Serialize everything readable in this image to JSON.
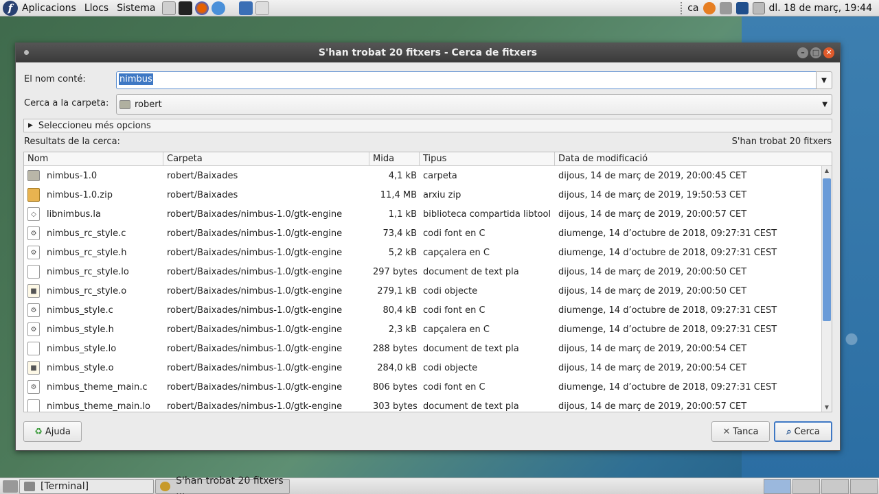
{
  "top_panel": {
    "menus": [
      "Aplicacions",
      "Llocs",
      "Sistema"
    ],
    "keyboard_layout": "ca",
    "clock": "dl. 18 de març, 19:44"
  },
  "window": {
    "title": "S'han trobat 20 fitxers - Cerca de fitxers",
    "name_label": "El nom conté:",
    "name_value": "nimbus",
    "folder_label": "Cerca a la carpeta:",
    "folder_value": "robert",
    "more_options": "Seleccioneu més opcions",
    "results_label": "Resultats de la cerca:",
    "results_count": "S'han trobat 20 fitxers",
    "columns": {
      "name": "Nom",
      "folder": "Carpeta",
      "size": "Mida",
      "type": "Tipus",
      "date": "Data de modificació"
    },
    "rows": [
      {
        "name": "nimbus-1.0",
        "folder": "robert/Baixades",
        "size": "4,1 kB",
        "type": "carpeta",
        "date": "dijous, 14 de març de 2019, 20:00:45 CET",
        "icon": "folder"
      },
      {
        "name": "nimbus-1.0.zip",
        "folder": "robert/Baixades",
        "size": "11,4 MB",
        "type": "arxiu zip",
        "date": "dijous, 14 de març de 2019, 19:50:53 CET",
        "icon": "zip"
      },
      {
        "name": "libnimbus.la",
        "folder": "robert/Baixades/nimbus-1.0/gtk-engine",
        "size": "1,1 kB",
        "type": "biblioteca compartida libtool",
        "date": "dijous, 14 de març de 2019, 20:00:57 CET",
        "icon": "lib"
      },
      {
        "name": "nimbus_rc_style.c",
        "folder": "robert/Baixades/nimbus-1.0/gtk-engine",
        "size": "73,4 kB",
        "type": "codi font en C",
        "date": "diumenge, 14 d’octubre de 2018, 09:27:31 CEST",
        "icon": "source"
      },
      {
        "name": "nimbus_rc_style.h",
        "folder": "robert/Baixades/nimbus-1.0/gtk-engine",
        "size": "5,2 kB",
        "type": "capçalera en C",
        "date": "diumenge, 14 d’octubre de 2018, 09:27:31 CEST",
        "icon": "source"
      },
      {
        "name": "nimbus_rc_style.lo",
        "folder": "robert/Baixades/nimbus-1.0/gtk-engine",
        "size": "297 bytes",
        "type": "document de text pla",
        "date": "dijous, 14 de març de 2019, 20:00:50 CET",
        "icon": "text"
      },
      {
        "name": "nimbus_rc_style.o",
        "folder": "robert/Baixades/nimbus-1.0/gtk-engine",
        "size": "279,1 kB",
        "type": "codi objecte",
        "date": "dijous, 14 de març de 2019, 20:00:50 CET",
        "icon": "object"
      },
      {
        "name": "nimbus_style.c",
        "folder": "robert/Baixades/nimbus-1.0/gtk-engine",
        "size": "80,4 kB",
        "type": "codi font en C",
        "date": "diumenge, 14 d’octubre de 2018, 09:27:31 CEST",
        "icon": "source"
      },
      {
        "name": "nimbus_style.h",
        "folder": "robert/Baixades/nimbus-1.0/gtk-engine",
        "size": "2,3 kB",
        "type": "capçalera en C",
        "date": "diumenge, 14 d’octubre de 2018, 09:27:31 CEST",
        "icon": "source"
      },
      {
        "name": "nimbus_style.lo",
        "folder": "robert/Baixades/nimbus-1.0/gtk-engine",
        "size": "288 bytes",
        "type": "document de text pla",
        "date": "dijous, 14 de març de 2019, 20:00:54 CET",
        "icon": "text"
      },
      {
        "name": "nimbus_style.o",
        "folder": "robert/Baixades/nimbus-1.0/gtk-engine",
        "size": "284,0 kB",
        "type": "codi objecte",
        "date": "dijous, 14 de març de 2019, 20:00:54 CET",
        "icon": "object"
      },
      {
        "name": "nimbus_theme_main.c",
        "folder": "robert/Baixades/nimbus-1.0/gtk-engine",
        "size": "806 bytes",
        "type": "codi font en C",
        "date": "diumenge, 14 d’octubre de 2018, 09:27:31 CEST",
        "icon": "source"
      },
      {
        "name": "nimbus_theme_main.lo",
        "folder": "robert/Baixades/nimbus-1.0/gtk-engine",
        "size": "303 bytes",
        "type": "document de text pla",
        "date": "dijous, 14 de març de 2019, 20:00:57 CET",
        "icon": "text"
      }
    ],
    "buttons": {
      "help": "Ajuda",
      "close": "Tanca",
      "search": "Cerca"
    }
  },
  "taskbar": {
    "tasks": [
      "[Terminal]",
      "S'han trobat 20 fitxers ..."
    ]
  },
  "colors": {
    "accent": "#3e78c4",
    "titlebar": "#444444",
    "close_button": "#e05a2b"
  }
}
